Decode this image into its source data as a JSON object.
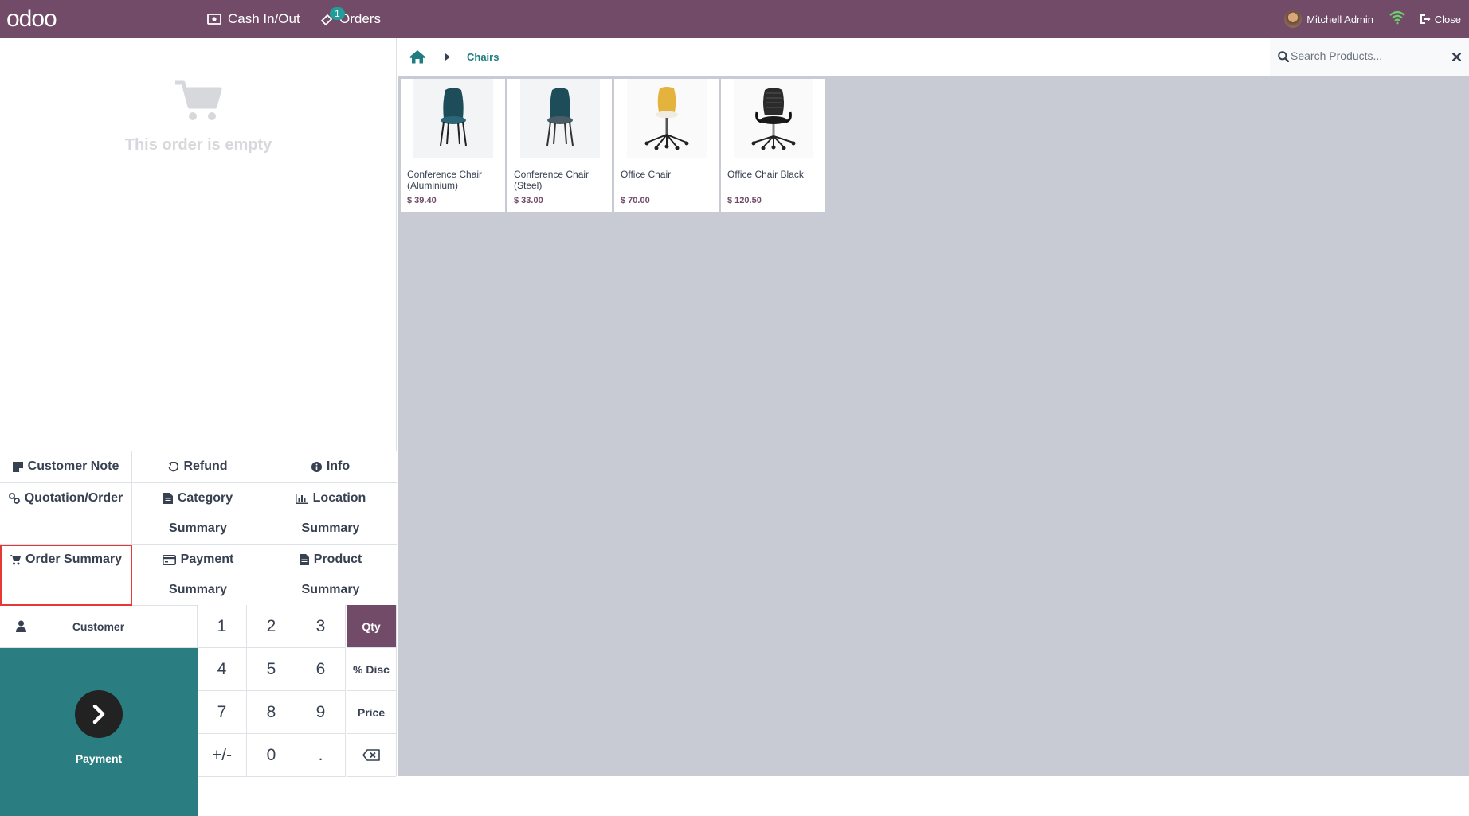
{
  "topbar": {
    "logo": "odoo",
    "cash_label": "Cash In/Out",
    "orders_label": "Orders",
    "orders_badge": "1",
    "user_name": "Mitchell Admin",
    "close_label": "Close"
  },
  "order": {
    "empty_text": "This order is empty"
  },
  "controls": {
    "customer_note": "Customer Note",
    "refund": "Refund",
    "info": "Info",
    "quotation": "Quotation/Order",
    "category_1": "Category",
    "category_2": "Summary",
    "location_1": "Location",
    "location_2": "Summary",
    "order_summary": "Order Summary",
    "payment_1": "Payment",
    "payment_2": "Summary",
    "product_1": "Product",
    "product_2": "Summary"
  },
  "numpad": {
    "customer": "Customer",
    "payment": "Payment",
    "keys": [
      "1",
      "2",
      "3",
      "4",
      "5",
      "6",
      "7",
      "8",
      "9",
      "+/-",
      "0",
      "."
    ],
    "modes": [
      "Qty",
      "% Disc",
      "Price"
    ],
    "active_mode": "Qty"
  },
  "breadcrumb": {
    "category": "Chairs"
  },
  "search": {
    "placeholder": "Search Products..."
  },
  "products": [
    {
      "name": "Conference Chair (Aluminium)",
      "price": "$ 39.40",
      "image": "teal-chair"
    },
    {
      "name": "Conference Chair (Steel)",
      "price": "$ 33.00",
      "image": "teal-chair"
    },
    {
      "name": "Office Chair",
      "price": "$ 70.00",
      "image": "yellow-swivel-chair"
    },
    {
      "name": "Office Chair Black",
      "price": "$ 120.50",
      "image": "black-office-chair"
    }
  ],
  "colors": {
    "brand": "#714b67",
    "teal": "#2a7d81",
    "highlight": "#e53935"
  }
}
